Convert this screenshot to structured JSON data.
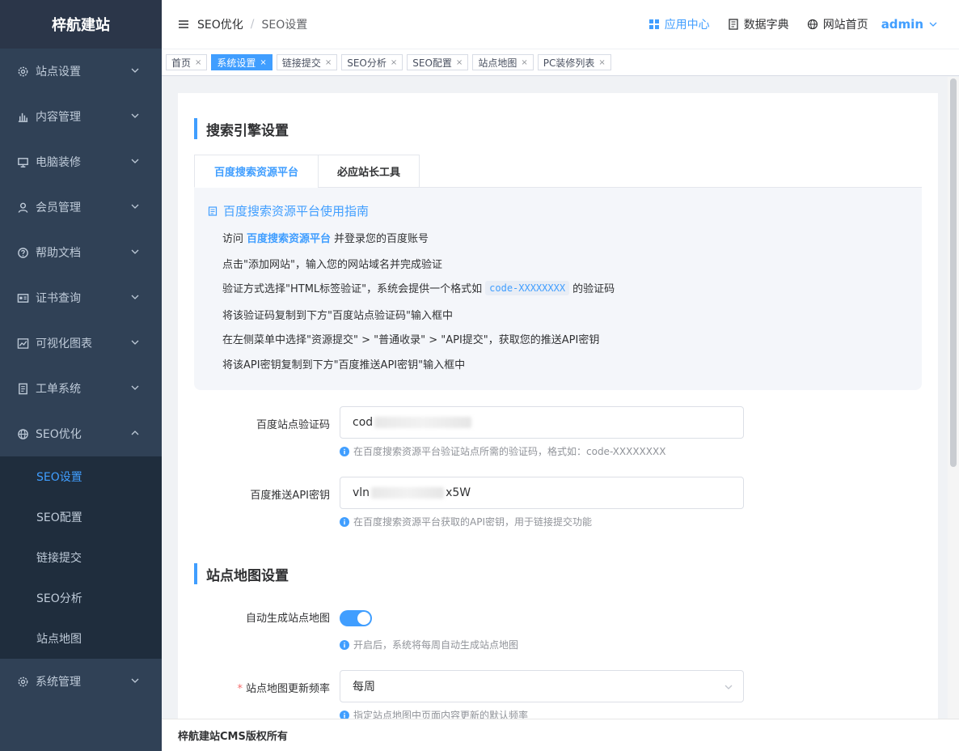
{
  "app": {
    "logo": "梓航建站"
  },
  "sidebar": {
    "items": [
      {
        "label": "站点设置",
        "icon": "gear-icon"
      },
      {
        "label": "内容管理",
        "icon": "bar-chart-icon"
      },
      {
        "label": "电脑装修",
        "icon": "monitor-icon"
      },
      {
        "label": "会员管理",
        "icon": "user-icon"
      },
      {
        "label": "帮助文档",
        "icon": "question-circle-icon"
      },
      {
        "label": "证书查询",
        "icon": "id-card-icon"
      },
      {
        "label": "可视化图表",
        "icon": "line-chart-icon"
      },
      {
        "label": "工单系统",
        "icon": "document-icon"
      },
      {
        "label": "SEO优化",
        "icon": "globe-icon"
      }
    ],
    "seo_submenu": [
      "SEO设置",
      "SEO配置",
      "链接提交",
      "SEO分析",
      "站点地图"
    ],
    "system": {
      "label": "系统管理",
      "icon": "gear-icon"
    }
  },
  "header": {
    "breadcrumb": [
      "SEO优化",
      "SEO设置"
    ],
    "links": {
      "app_center": "应用中心",
      "data_dict": "数据字典",
      "site_home": "网站首页"
    },
    "user": "admin"
  },
  "tags": [
    {
      "label": "首页",
      "active": false
    },
    {
      "label": "系统设置",
      "active": true
    },
    {
      "label": "链接提交",
      "active": false
    },
    {
      "label": "SEO分析",
      "active": false
    },
    {
      "label": "SEO配置",
      "active": false
    },
    {
      "label": "站点地图",
      "active": false
    },
    {
      "label": "PC装修列表",
      "active": false
    }
  ],
  "search_section": {
    "title": "搜索引擎设置",
    "tabs": [
      "百度搜索资源平台",
      "必应站长工具"
    ],
    "guide": {
      "title": "百度搜索资源平台使用指南",
      "step1_before": "访问",
      "step1_link": "百度搜索资源平台",
      "step1_after": "并登录您的百度账号",
      "step2": "点击\"添加网站\"，输入您的网站域名并完成验证",
      "step3_before": "验证方式选择\"HTML标签验证\"，系统会提供一个格式如",
      "step3_code": "code-XXXXXXXX",
      "step3_after": "的验证码",
      "step4": "将该验证码复制到下方\"百度站点验证码\"输入框中",
      "step5": "在左侧菜单中选择\"资源提交\" > \"普通收录\" > \"API提交\"，获取您的推送API密钥",
      "step6": "将该API密钥复制到下方\"百度推送API密钥\"输入框中"
    },
    "verify": {
      "label": "百度站点验证码",
      "value_prefix": "cod",
      "hint": "在百度搜索资源平台验证站点所需的验证码，格式如：code-XXXXXXXX"
    },
    "api_key": {
      "label": "百度推送API密钥",
      "value_prefix": "vln",
      "value_suffix": "x5W",
      "hint": "在百度搜索资源平台获取的API密钥，用于链接提交功能"
    }
  },
  "sitemap_section": {
    "title": "站点地图设置",
    "auto": {
      "label": "自动生成站点地图",
      "enabled": true,
      "hint": "开启后，系统将每周自动生成站点地图"
    },
    "frequency": {
      "label": "站点地图更新频率",
      "value": "每周",
      "hint": "指定站点地图中页面内容更新的默认频率"
    }
  },
  "footer": "梓航建站CMS版权所有",
  "colors": {
    "primary": "#409eff",
    "sidebar": "#304156",
    "submenu": "#1f2d3d"
  }
}
